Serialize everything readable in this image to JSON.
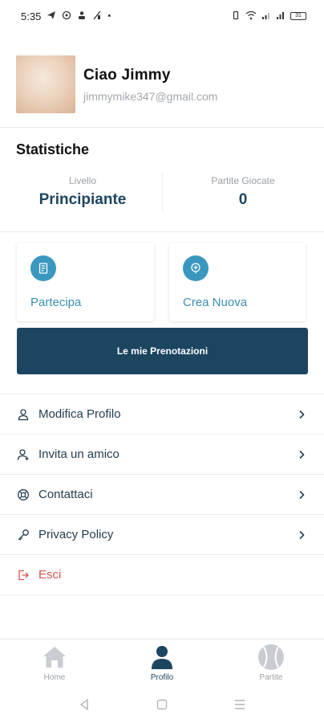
{
  "status_bar": {
    "time": "5:35",
    "battery": "31",
    "left_icons": [
      "telegram-icon",
      "whatsapp-icon",
      "person-icon",
      "signal-off-icon",
      "dot-icon"
    ],
    "right_icons": [
      "vibrate-icon",
      "wifi-icon",
      "signal-icon",
      "signal-icon",
      "battery-icon"
    ]
  },
  "profile": {
    "greeting": "Ciao Jimmy",
    "email": "jimmymike347@gmail.com"
  },
  "stats": {
    "title": "Statistiche",
    "level_label": "Livello",
    "level_value": "Principiante",
    "matches_label": "Partite Giocate",
    "matches_value": "0"
  },
  "actions": {
    "join_label": "Partecipa",
    "create_label": "Crea Nuova",
    "bookings_label": "Le mie Prenotazioni"
  },
  "menu": {
    "items": [
      {
        "label": "Modifica Profilo",
        "icon": "user-icon"
      },
      {
        "label": "Invita un amico",
        "icon": "add-user-icon"
      },
      {
        "label": "Contattaci",
        "icon": "support-icon"
      },
      {
        "label": "Privacy Policy",
        "icon": "key-icon"
      },
      {
        "label": "Esci",
        "icon": "logout-icon"
      }
    ]
  },
  "bottom_nav": {
    "home": "Home",
    "profile": "Profilo",
    "matches": "Partite",
    "active": "Profilo"
  },
  "colors": {
    "primary": "#1c4560",
    "accent": "#3a97bf",
    "danger": "#d9534f",
    "muted": "#9aa0a6"
  }
}
